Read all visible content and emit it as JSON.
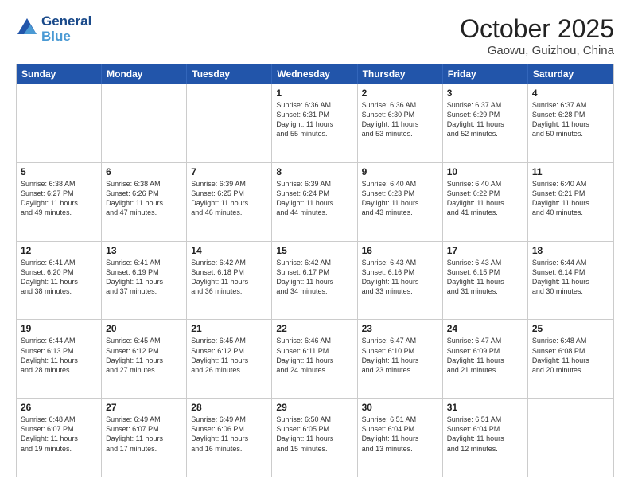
{
  "header": {
    "logo_line1": "General",
    "logo_line2": "Blue",
    "month": "October 2025",
    "location": "Gaowu, Guizhou, China"
  },
  "weekdays": [
    "Sunday",
    "Monday",
    "Tuesday",
    "Wednesday",
    "Thursday",
    "Friday",
    "Saturday"
  ],
  "rows": [
    [
      {
        "day": "",
        "text": ""
      },
      {
        "day": "",
        "text": ""
      },
      {
        "day": "",
        "text": ""
      },
      {
        "day": "1",
        "text": "Sunrise: 6:36 AM\nSunset: 6:31 PM\nDaylight: 11 hours\nand 55 minutes."
      },
      {
        "day": "2",
        "text": "Sunrise: 6:36 AM\nSunset: 6:30 PM\nDaylight: 11 hours\nand 53 minutes."
      },
      {
        "day": "3",
        "text": "Sunrise: 6:37 AM\nSunset: 6:29 PM\nDaylight: 11 hours\nand 52 minutes."
      },
      {
        "day": "4",
        "text": "Sunrise: 6:37 AM\nSunset: 6:28 PM\nDaylight: 11 hours\nand 50 minutes."
      }
    ],
    [
      {
        "day": "5",
        "text": "Sunrise: 6:38 AM\nSunset: 6:27 PM\nDaylight: 11 hours\nand 49 minutes."
      },
      {
        "day": "6",
        "text": "Sunrise: 6:38 AM\nSunset: 6:26 PM\nDaylight: 11 hours\nand 47 minutes."
      },
      {
        "day": "7",
        "text": "Sunrise: 6:39 AM\nSunset: 6:25 PM\nDaylight: 11 hours\nand 46 minutes."
      },
      {
        "day": "8",
        "text": "Sunrise: 6:39 AM\nSunset: 6:24 PM\nDaylight: 11 hours\nand 44 minutes."
      },
      {
        "day": "9",
        "text": "Sunrise: 6:40 AM\nSunset: 6:23 PM\nDaylight: 11 hours\nand 43 minutes."
      },
      {
        "day": "10",
        "text": "Sunrise: 6:40 AM\nSunset: 6:22 PM\nDaylight: 11 hours\nand 41 minutes."
      },
      {
        "day": "11",
        "text": "Sunrise: 6:40 AM\nSunset: 6:21 PM\nDaylight: 11 hours\nand 40 minutes."
      }
    ],
    [
      {
        "day": "12",
        "text": "Sunrise: 6:41 AM\nSunset: 6:20 PM\nDaylight: 11 hours\nand 38 minutes."
      },
      {
        "day": "13",
        "text": "Sunrise: 6:41 AM\nSunset: 6:19 PM\nDaylight: 11 hours\nand 37 minutes."
      },
      {
        "day": "14",
        "text": "Sunrise: 6:42 AM\nSunset: 6:18 PM\nDaylight: 11 hours\nand 36 minutes."
      },
      {
        "day": "15",
        "text": "Sunrise: 6:42 AM\nSunset: 6:17 PM\nDaylight: 11 hours\nand 34 minutes."
      },
      {
        "day": "16",
        "text": "Sunrise: 6:43 AM\nSunset: 6:16 PM\nDaylight: 11 hours\nand 33 minutes."
      },
      {
        "day": "17",
        "text": "Sunrise: 6:43 AM\nSunset: 6:15 PM\nDaylight: 11 hours\nand 31 minutes."
      },
      {
        "day": "18",
        "text": "Sunrise: 6:44 AM\nSunset: 6:14 PM\nDaylight: 11 hours\nand 30 minutes."
      }
    ],
    [
      {
        "day": "19",
        "text": "Sunrise: 6:44 AM\nSunset: 6:13 PM\nDaylight: 11 hours\nand 28 minutes."
      },
      {
        "day": "20",
        "text": "Sunrise: 6:45 AM\nSunset: 6:12 PM\nDaylight: 11 hours\nand 27 minutes."
      },
      {
        "day": "21",
        "text": "Sunrise: 6:45 AM\nSunset: 6:12 PM\nDaylight: 11 hours\nand 26 minutes."
      },
      {
        "day": "22",
        "text": "Sunrise: 6:46 AM\nSunset: 6:11 PM\nDaylight: 11 hours\nand 24 minutes."
      },
      {
        "day": "23",
        "text": "Sunrise: 6:47 AM\nSunset: 6:10 PM\nDaylight: 11 hours\nand 23 minutes."
      },
      {
        "day": "24",
        "text": "Sunrise: 6:47 AM\nSunset: 6:09 PM\nDaylight: 11 hours\nand 21 minutes."
      },
      {
        "day": "25",
        "text": "Sunrise: 6:48 AM\nSunset: 6:08 PM\nDaylight: 11 hours\nand 20 minutes."
      }
    ],
    [
      {
        "day": "26",
        "text": "Sunrise: 6:48 AM\nSunset: 6:07 PM\nDaylight: 11 hours\nand 19 minutes."
      },
      {
        "day": "27",
        "text": "Sunrise: 6:49 AM\nSunset: 6:07 PM\nDaylight: 11 hours\nand 17 minutes."
      },
      {
        "day": "28",
        "text": "Sunrise: 6:49 AM\nSunset: 6:06 PM\nDaylight: 11 hours\nand 16 minutes."
      },
      {
        "day": "29",
        "text": "Sunrise: 6:50 AM\nSunset: 6:05 PM\nDaylight: 11 hours\nand 15 minutes."
      },
      {
        "day": "30",
        "text": "Sunrise: 6:51 AM\nSunset: 6:04 PM\nDaylight: 11 hours\nand 13 minutes."
      },
      {
        "day": "31",
        "text": "Sunrise: 6:51 AM\nSunset: 6:04 PM\nDaylight: 11 hours\nand 12 minutes."
      },
      {
        "day": "",
        "text": ""
      }
    ]
  ]
}
